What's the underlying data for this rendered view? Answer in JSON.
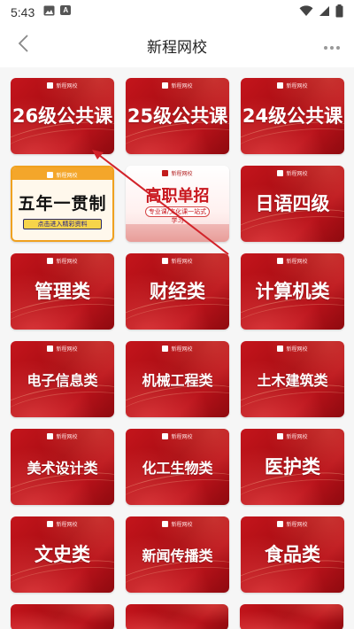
{
  "status_bar": {
    "time": "5:43",
    "icons_left": [
      "image-icon",
      "a-icon"
    ],
    "a_letter": "A",
    "icons_right": [
      "wifi-icon",
      "signal-icon",
      "battery-icon"
    ]
  },
  "nav": {
    "title": "新程网校",
    "back_icon": "chevron-left-icon",
    "more_icon": "more-dots-icon"
  },
  "brand_text": "新程网校",
  "cards": [
    {
      "label": "26级公共课",
      "style": "red",
      "size": "lg"
    },
    {
      "label": "25级公共课",
      "style": "red",
      "size": "lg"
    },
    {
      "label": "24级公共课",
      "style": "red",
      "size": "lg"
    },
    {
      "label": "五年一贯制",
      "style": "wnyg",
      "size": "lg",
      "sub": "点击进入精彩资料"
    },
    {
      "label": "高职单招",
      "style": "gzdz",
      "size": "lg",
      "sub": "专业课/文化课一站式学习"
    },
    {
      "label": "日语四级",
      "style": "red",
      "size": "lg"
    },
    {
      "label": "管理类",
      "style": "red",
      "size": "lg"
    },
    {
      "label": "财经类",
      "style": "red",
      "size": "lg"
    },
    {
      "label": "计算机类",
      "style": "red",
      "size": "lg"
    },
    {
      "label": "电子信息类",
      "style": "red",
      "size": "md"
    },
    {
      "label": "机械工程类",
      "style": "red",
      "size": "md"
    },
    {
      "label": "土木建筑类",
      "style": "red",
      "size": "md"
    },
    {
      "label": "美术设计类",
      "style": "red",
      "size": "md"
    },
    {
      "label": "化工生物类",
      "style": "red",
      "size": "md"
    },
    {
      "label": "医护类",
      "style": "red",
      "size": "lg"
    },
    {
      "label": "文史类",
      "style": "red",
      "size": "lg"
    },
    {
      "label": "新闻传播类",
      "style": "red",
      "size": "md"
    },
    {
      "label": "食品类",
      "style": "red",
      "size": "lg"
    }
  ],
  "annotation": {
    "type": "arrow",
    "color": "#d2232a"
  },
  "colors": {
    "card_red": "#b8121a",
    "accent_orange": "#f0a11f",
    "background": "#f6f6f6"
  }
}
